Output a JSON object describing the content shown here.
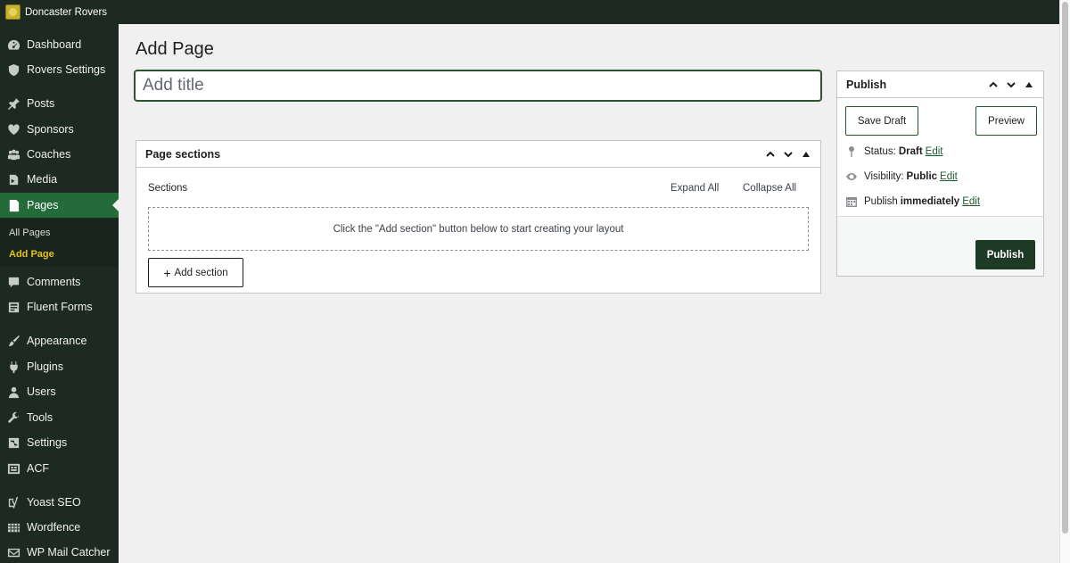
{
  "admin_bar": {
    "site_name": "Doncaster Rovers"
  },
  "sidebar": {
    "items": [
      {
        "label": "Dashboard",
        "icon": "dashboard-icon"
      },
      {
        "label": "Rovers Settings",
        "icon": "shield-icon"
      },
      {
        "label": "Posts",
        "icon": "pin-icon"
      },
      {
        "label": "Sponsors",
        "icon": "heart-icon"
      },
      {
        "label": "Coaches",
        "icon": "groups-icon"
      },
      {
        "label": "Media",
        "icon": "media-icon"
      },
      {
        "label": "Pages",
        "icon": "page-icon",
        "current": true
      },
      {
        "label": "Comments",
        "icon": "comment-icon"
      },
      {
        "label": "Fluent Forms",
        "icon": "form-icon"
      },
      {
        "label": "Appearance",
        "icon": "brush-icon"
      },
      {
        "label": "Plugins",
        "icon": "plug-icon"
      },
      {
        "label": "Users",
        "icon": "user-icon"
      },
      {
        "label": "Tools",
        "icon": "wrench-icon"
      },
      {
        "label": "Settings",
        "icon": "settings-icon"
      },
      {
        "label": "ACF",
        "icon": "acf-icon"
      },
      {
        "label": "Yoast SEO",
        "icon": "yoast-icon"
      },
      {
        "label": "Wordfence",
        "icon": "wordfence-icon"
      },
      {
        "label": "WP Mail Catcher",
        "icon": "mail-icon"
      }
    ],
    "submenu": [
      {
        "label": "All Pages"
      },
      {
        "label": "Add Page",
        "current": true
      }
    ]
  },
  "main": {
    "page_title": "Add Page",
    "title_placeholder": "Add title",
    "sections_box": {
      "title": "Page sections",
      "sections_label": "Sections",
      "expand_all": "Expand All",
      "collapse_all": "Collapse All",
      "empty_message": "Click the \"Add section\" button below to start creating your layout",
      "add_section": "Add section"
    },
    "publish_box": {
      "title": "Publish",
      "save_draft": "Save Draft",
      "preview": "Preview",
      "status_label": "Status:",
      "status_value": "Draft",
      "visibility_label": "Visibility:",
      "visibility_value": "Public",
      "publish_label": "Publish",
      "publish_value": "immediately",
      "edit": "Edit",
      "publish_button": "Publish"
    }
  },
  "colors": {
    "sidebar_bg": "#1d2a21",
    "current_menu_bg": "#246b3a",
    "submenu_current": "#e4c320",
    "primary_button": "#1d3a25"
  }
}
